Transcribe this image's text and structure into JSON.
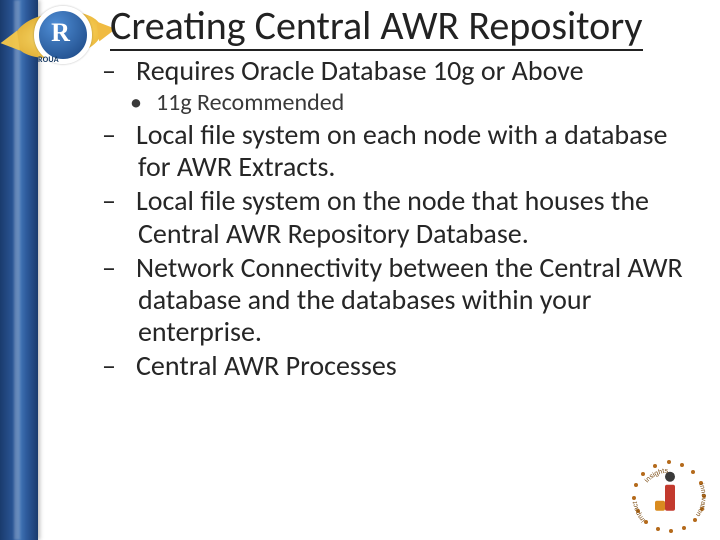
{
  "logo": {
    "letter": "R",
    "caption": "ROUA"
  },
  "title": "Creating Central AWR Repository",
  "bullets": {
    "req": "Requires Oracle Database 10g or Above",
    "sub": "11g Recommended",
    "b1": "Local file system on each node with a database for AWR Extracts.",
    "b2": "Local file system on the node that houses the Central AWR Repository Database.",
    "b3": "Network Connectivity between the Central AWR database and the databases within your enterprise.",
    "b4": "Central AWR Processes"
  },
  "dash": "–",
  "dot": "•",
  "corner": {
    "top": "insights",
    "right": "innovation",
    "bottom": "impact"
  }
}
